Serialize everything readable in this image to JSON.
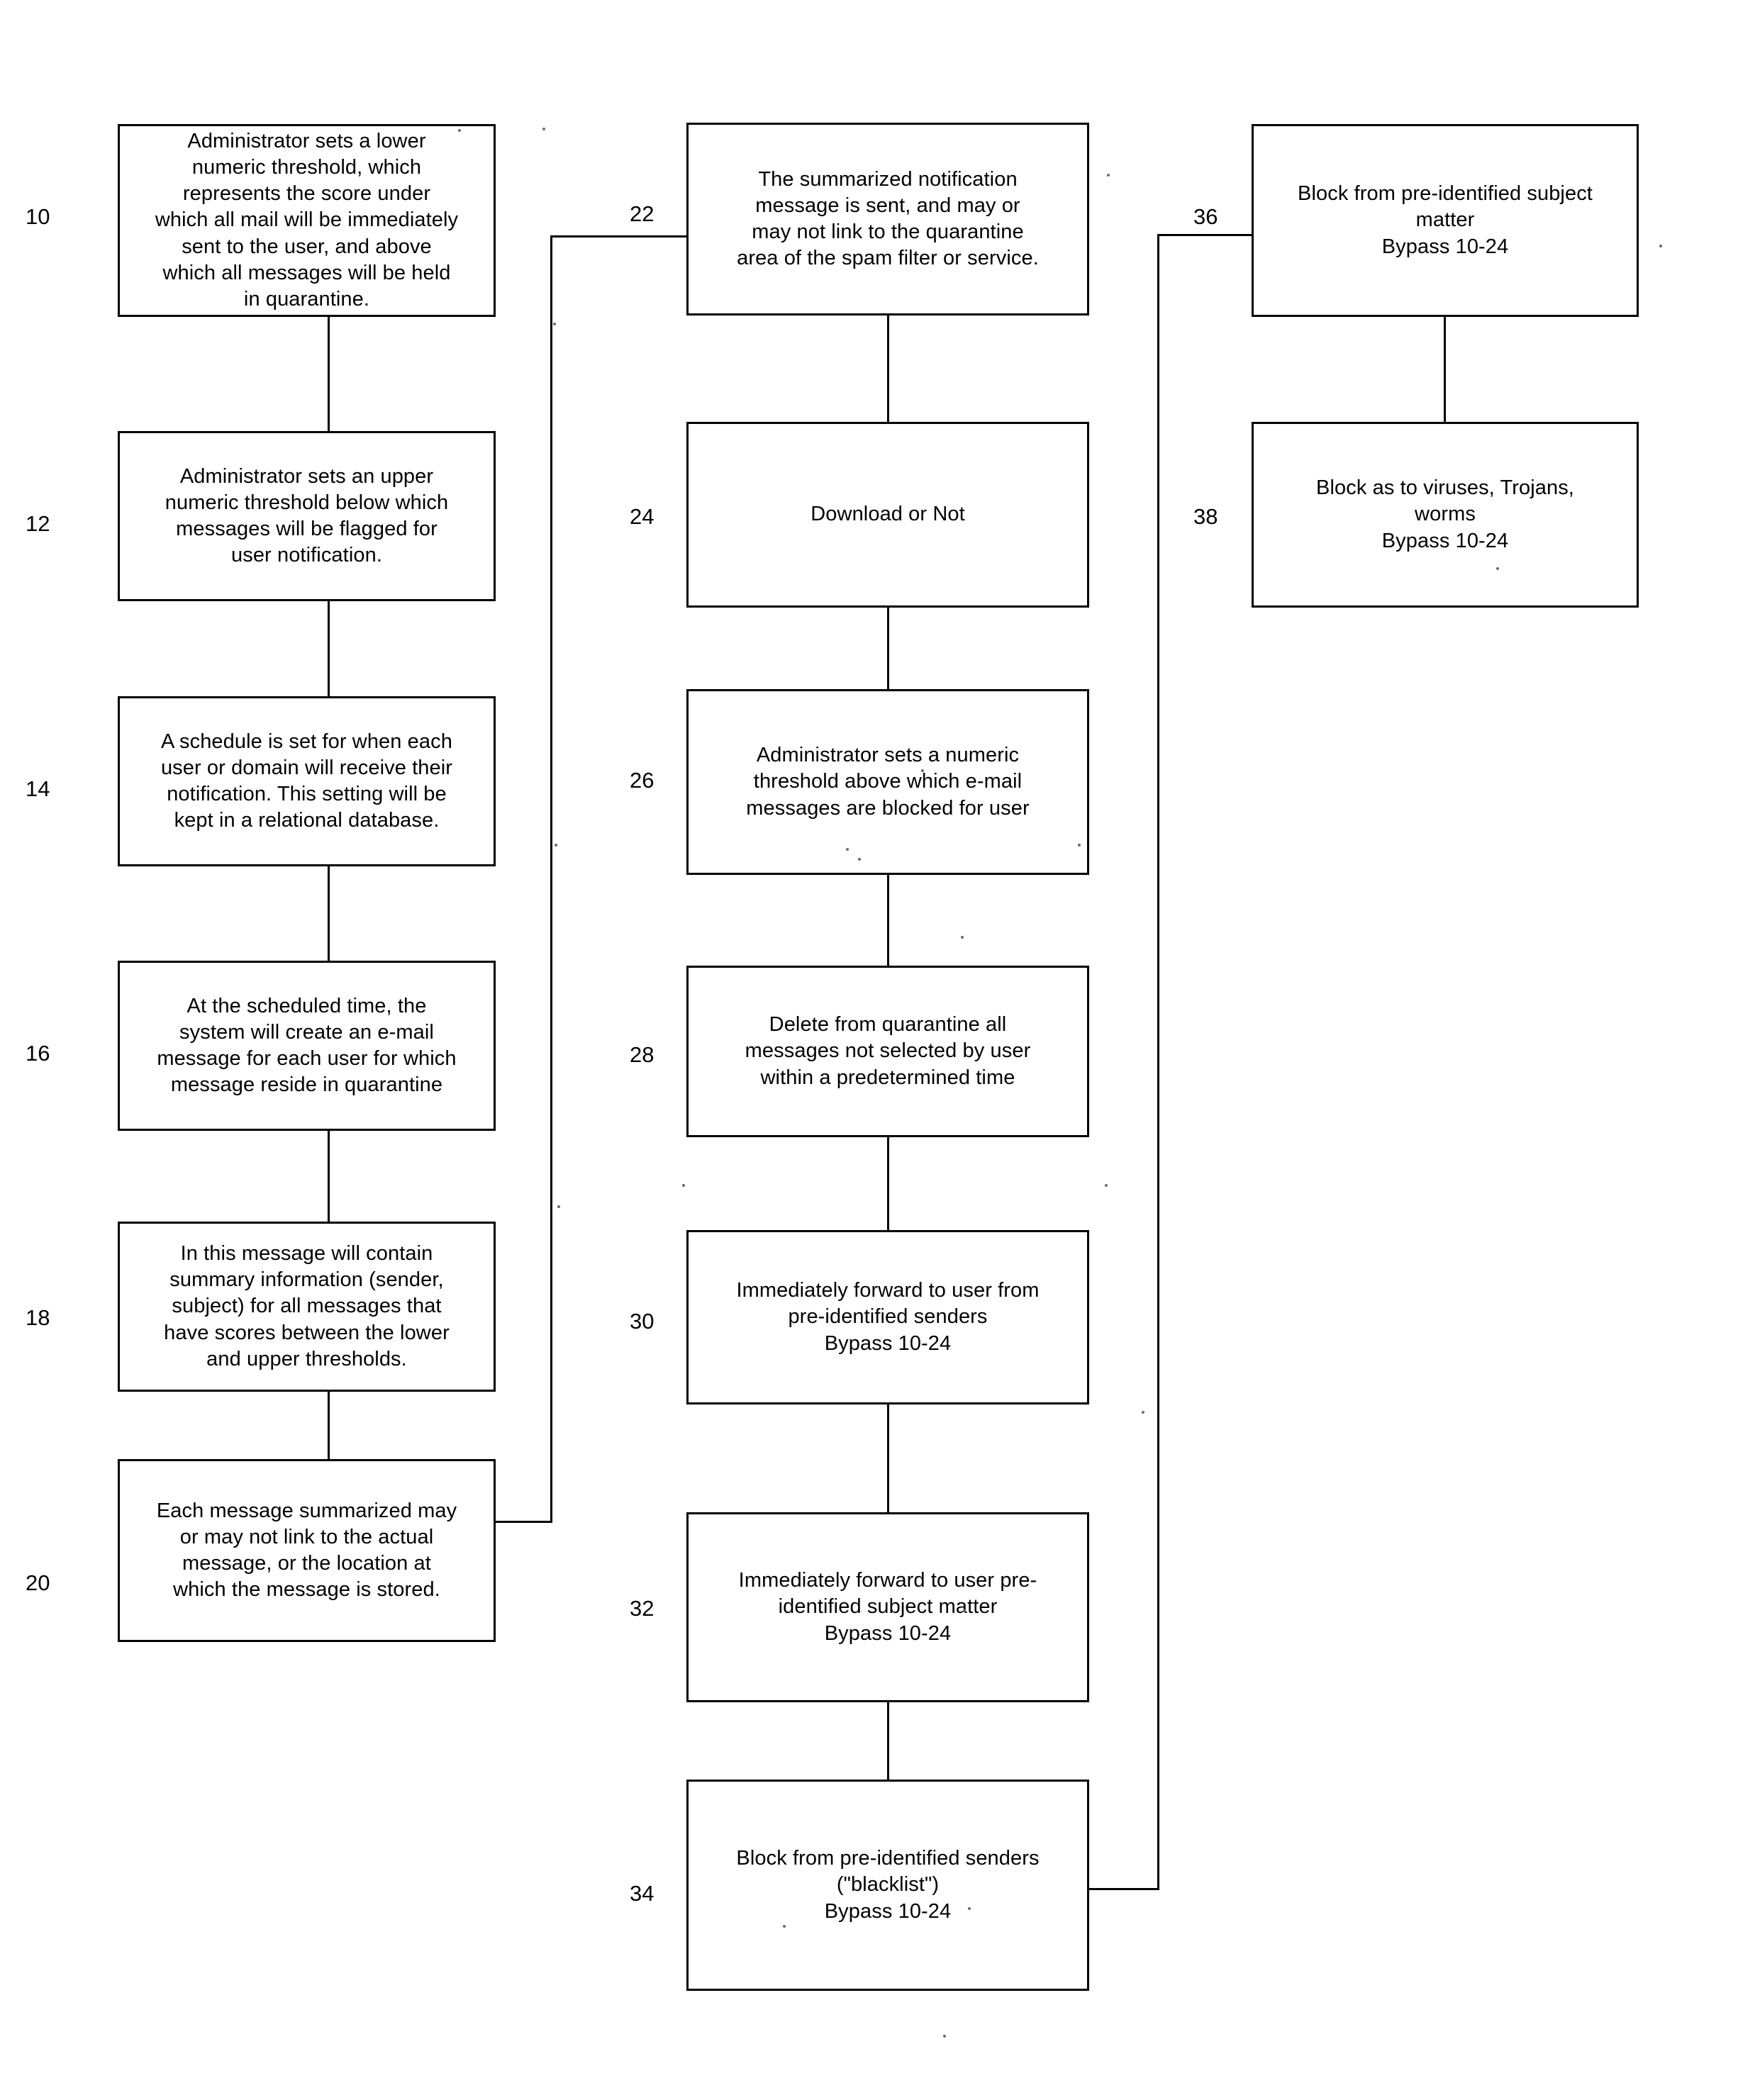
{
  "diagram": {
    "title": "Spam quarantine notification and filtering flowchart",
    "line_color": "#000000",
    "background_color": "#ffffff"
  },
  "columns": {
    "left": {
      "nodes": [
        {
          "ref": "10",
          "text": "Administrator sets a lower\nnumeric threshold, which\nrepresents the score under\nwhich all mail will be immediately\nsent to the user, and above\nwhich all messages will be held\nin quarantine."
        },
        {
          "ref": "12",
          "text": "Administrator sets an upper\nnumeric threshold below which\nmessages will be flagged for\nuser notification."
        },
        {
          "ref": "14",
          "text": "A schedule is set for when each\nuser or domain will receive their\nnotification.  This setting will be\nkept in a relational database."
        },
        {
          "ref": "16",
          "text": "At the scheduled time, the\nsystem will create an e-mail\nmessage for each user for which\nmessage reside in quarantine"
        },
        {
          "ref": "18",
          "text": "In this message will contain\nsummary information (sender,\nsubject) for all messages that\nhave scores between the lower\nand upper thresholds."
        },
        {
          "ref": "20",
          "text": "Each message summarized may\nor may not link to the actual\nmessage, or the location at\nwhich the message is stored."
        }
      ]
    },
    "middle": {
      "nodes": [
        {
          "ref": "22",
          "text": "The summarized notification\nmessage is sent, and may or\nmay not link to the quarantine\narea of the spam filter or service."
        },
        {
          "ref": "24",
          "text": "Download or Not"
        },
        {
          "ref": "26",
          "text": "Administrator sets a numeric\nthreshold above which e-mail\nmessages are blocked for user"
        },
        {
          "ref": "28",
          "text": "Delete from quarantine all\nmessages not selected by user\nwithin a predetermined time"
        },
        {
          "ref": "30",
          "text": "Immediately forward to user from\npre-identified senders\nBypass 10-24"
        },
        {
          "ref": "32",
          "text": "Immediately forward to user pre-\nidentified subject matter\nBypass 10-24"
        },
        {
          "ref": "34",
          "text": "Block from pre-identified senders\n(\"blacklist\")\nBypass 10-24"
        }
      ]
    },
    "right": {
      "nodes": [
        {
          "ref": "36",
          "text": "Block from pre-identified subject\nmatter\nBypass 10-24"
        },
        {
          "ref": "38",
          "text": "Block as to viruses, Trojans,\nworms\nBypass 10-24"
        }
      ]
    }
  }
}
